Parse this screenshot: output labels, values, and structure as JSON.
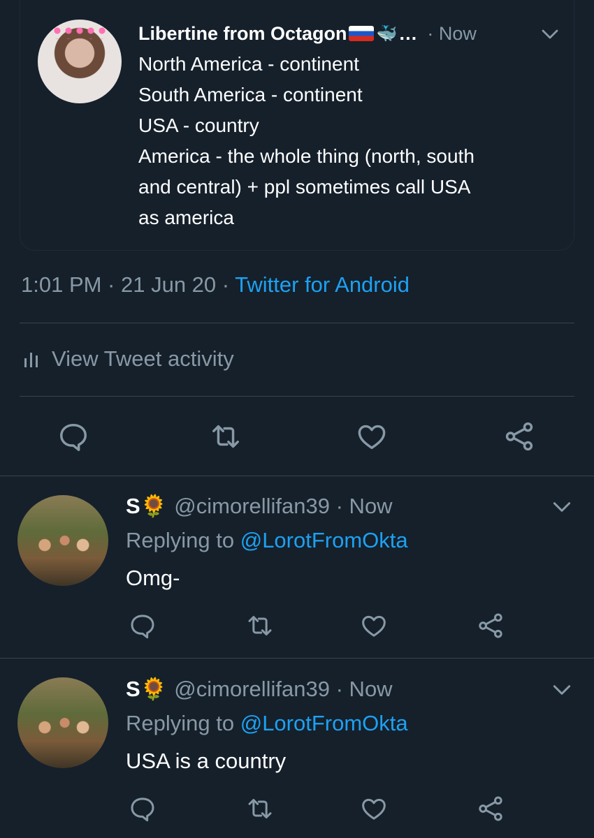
{
  "quoted_tweet": {
    "name": "Libertine from Octagon",
    "ellipsis": "…",
    "meta": "· Now",
    "lines": [
      "North America - continent",
      "South America - continent",
      "USA - country",
      "America - the whole thing (north, south",
      "and central) + ppl sometimes call USA",
      "as america"
    ]
  },
  "tweet_info": {
    "time_date": "1:01 PM · 21 Jun 20 · ",
    "source": "Twitter for Android"
  },
  "activity": {
    "label": "View Tweet activity"
  },
  "replies": [
    {
      "name": "S🌻",
      "meta": "@cimorellifan39 · Now",
      "replying_prefix": "Replying to ",
      "replying_handle": "@LorotFromOkta",
      "text": "Omg-"
    },
    {
      "name": "S🌻",
      "meta": "@cimorellifan39 · Now",
      "replying_prefix": "Replying to ",
      "replying_handle": "@LorotFromOkta",
      "text": "USA is a country"
    }
  ],
  "colors": {
    "background": "#15202b",
    "secondary_text": "#8899a6",
    "accent": "#1da1f2",
    "divider": "#38444d"
  },
  "icons": [
    "reply-icon",
    "retweet-icon",
    "like-icon",
    "share-icon",
    "chevron-down-icon",
    "bar-chart-icon"
  ]
}
